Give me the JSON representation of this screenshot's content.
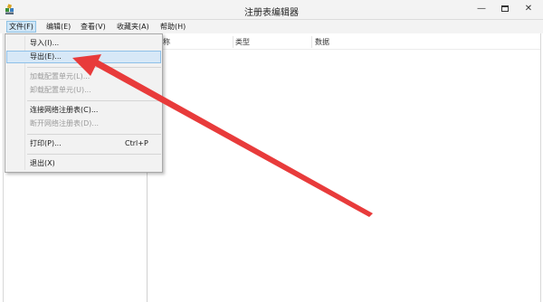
{
  "window": {
    "title": "注册表编辑器"
  },
  "menubar": {
    "items": [
      {
        "label": "文件(F)"
      },
      {
        "label": "编辑(E)"
      },
      {
        "label": "查看(V)"
      },
      {
        "label": "收藏夹(A)"
      },
      {
        "label": "帮助(H)"
      }
    ]
  },
  "file_menu": {
    "items": [
      {
        "label": "导入(I)...",
        "enabled": true
      },
      {
        "label": "导出(E)...",
        "enabled": true,
        "highlighted": true
      },
      {
        "label": "加载配置单元(L)...",
        "enabled": false
      },
      {
        "label": "卸载配置单元(U)...",
        "enabled": false
      },
      {
        "label": "连接网络注册表(C)...",
        "enabled": true
      },
      {
        "label": "断开网络注册表(D)...",
        "enabled": false
      },
      {
        "label": "打印(P)...",
        "enabled": true,
        "shortcut": "Ctrl+P"
      },
      {
        "label": "退出(X)",
        "enabled": true
      }
    ]
  },
  "list": {
    "columns": [
      {
        "label": "名称"
      },
      {
        "label": "类型"
      },
      {
        "label": "数据"
      }
    ]
  },
  "annotation": {
    "arrow_color": "#e83b3b"
  },
  "icons": {
    "app": "registry-editor-icon",
    "minimize": "minimize-icon",
    "maximize": "maximize-icon",
    "close": "close-icon"
  }
}
